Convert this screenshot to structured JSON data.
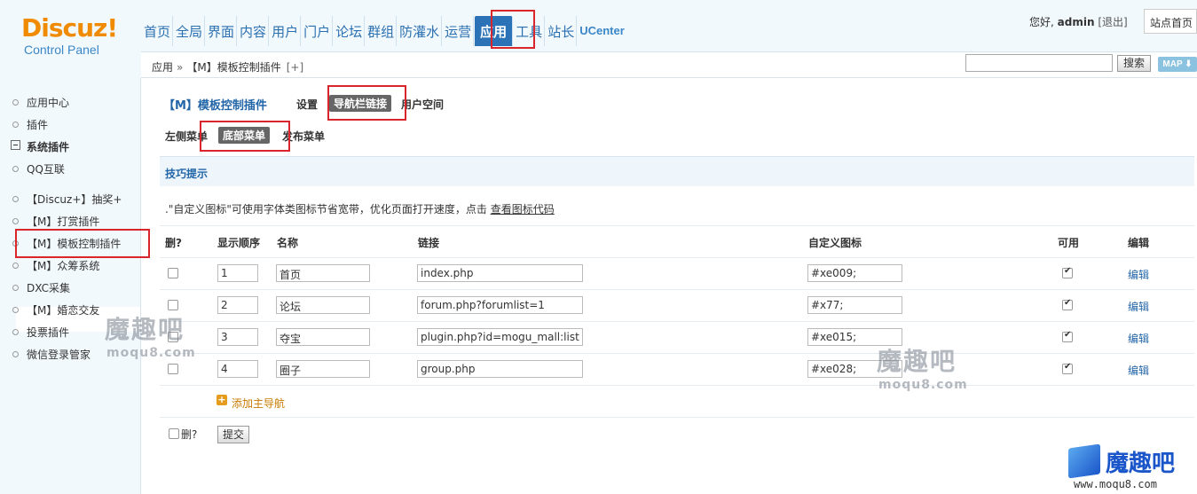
{
  "logo": {
    "main": "Discuz!",
    "sub": "Control Panel"
  },
  "topnav": {
    "items": [
      {
        "label": "首页"
      },
      {
        "label": "全局"
      },
      {
        "label": "界面"
      },
      {
        "label": "内容"
      },
      {
        "label": "用户"
      },
      {
        "label": "门户"
      },
      {
        "label": "论坛"
      },
      {
        "label": "群组"
      },
      {
        "label": "防灌水"
      },
      {
        "label": "运营"
      },
      {
        "label": "应用",
        "active": true
      },
      {
        "label": "工具"
      },
      {
        "label": "站长"
      },
      {
        "label": "UCenter"
      }
    ]
  },
  "userbar": {
    "greeting": "您好,",
    "username": "admin",
    "logout": "[退出]",
    "site_home": "站点首页"
  },
  "breadcrumb": {
    "root": "应用",
    "sep": "»",
    "current": "【M】模板控制插件",
    "add": "[+]"
  },
  "search": {
    "button": "搜索",
    "map": "MAP ⬇"
  },
  "sidebar": {
    "items": [
      {
        "label": "应用中心"
      },
      {
        "label": "插件"
      },
      {
        "label": "系统插件",
        "group": true
      },
      {
        "label": "QQ互联"
      },
      {
        "label": "【Discuz+】抽奖+"
      },
      {
        "label": "【M】打赏插件"
      },
      {
        "label": "【M】模板控制插件",
        "selected": true
      },
      {
        "label": "【M】众筹系统"
      },
      {
        "label": "DXC采集"
      },
      {
        "label": "【M】婚恋交友"
      },
      {
        "label": "投票插件"
      },
      {
        "label": "微信登录管家"
      }
    ]
  },
  "main": {
    "plugin_title": "【M】模板控制插件",
    "tabs": [
      {
        "label": "设置"
      },
      {
        "label": "导航栏链接",
        "active": true
      },
      {
        "label": "用户空间"
      }
    ],
    "subtabs": [
      {
        "label": "左侧菜单"
      },
      {
        "label": "底部菜单",
        "active": true
      },
      {
        "label": "发布菜单"
      }
    ],
    "tips_title": "技巧提示",
    "tip_text": ".\"自定义图标\"可使用字体类图标节省宽带，优化页面打开速度，点击",
    "tip_link": "查看图标代码",
    "columns": {
      "del": "删?",
      "order": "显示顺序",
      "name": "名称",
      "link": "链接",
      "icon": "自定义图标",
      "enabled": "可用",
      "edit": "编辑"
    },
    "rows": [
      {
        "order": "1",
        "name": "首页",
        "link": "index.php",
        "icon": "#xe009;",
        "enabled": true,
        "edit": "编辑"
      },
      {
        "order": "2",
        "name": "论坛",
        "link": "forum.php?forumlist=1",
        "icon": "#x77;",
        "enabled": true,
        "edit": "编辑"
      },
      {
        "order": "3",
        "name": "夺宝",
        "link": "plugin.php?id=mogu_mall:list",
        "icon": "#xe015;",
        "enabled": true,
        "edit": "编辑"
      },
      {
        "order": "4",
        "name": "圈子",
        "link": "group.php",
        "icon": "#xe028;",
        "enabled": true,
        "edit": "编辑"
      }
    ],
    "add_nav": "添加主导航",
    "add_icon": "plus-icon",
    "bottom_del": "删?",
    "submit": "提交"
  },
  "watermarks": {
    "main": "魔趣吧",
    "sub": "moqu8.com",
    "corner_main": "魔趣吧",
    "corner_sub": "www.moqu8.com"
  },
  "colors": {
    "accent": "#2b73b6",
    "logo": "#f08a00",
    "highlight": "#d9262c"
  }
}
